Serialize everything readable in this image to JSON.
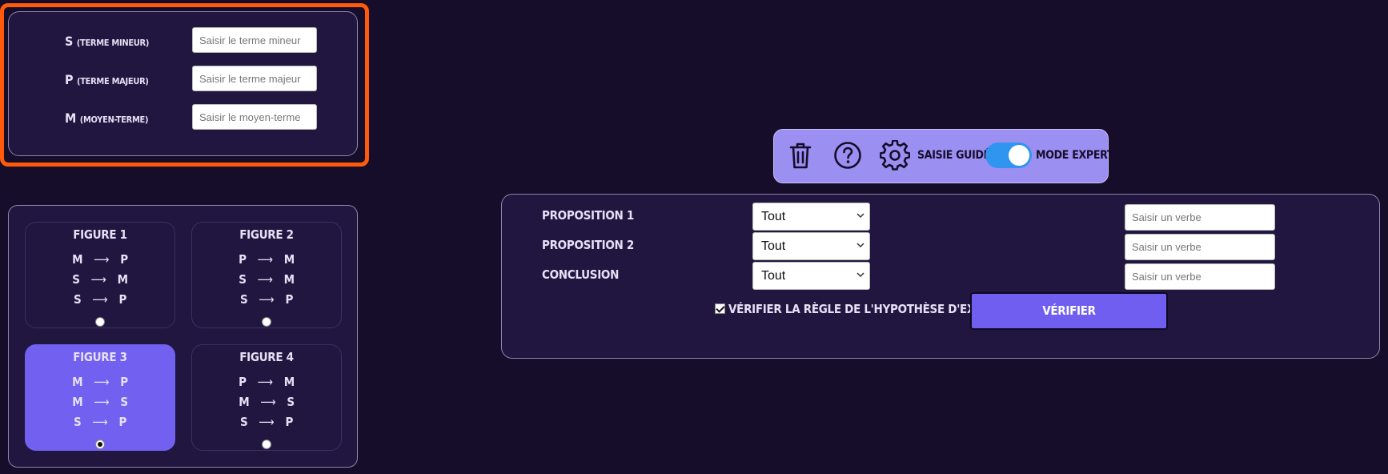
{
  "terms": {
    "s": {
      "letter": "S",
      "desc": "(TERME MINEUR)",
      "placeholder": "Saisir le terme mineur"
    },
    "p": {
      "letter": "P",
      "desc": "(TERME MAJEUR)",
      "placeholder": "Saisir le terme majeur"
    },
    "m": {
      "letter": "M",
      "desc": "(MOYEN-TERME)",
      "placeholder": "Saisir le moyen-terme"
    }
  },
  "figures": [
    {
      "title": "FIGURE 1",
      "lines": [
        [
          "M",
          "P"
        ],
        [
          "S",
          "M"
        ],
        [
          "S",
          "P"
        ]
      ],
      "selected": false
    },
    {
      "title": "FIGURE 2",
      "lines": [
        [
          "P",
          "M"
        ],
        [
          "S",
          "M"
        ],
        [
          "S",
          "P"
        ]
      ],
      "selected": false
    },
    {
      "title": "FIGURE 3",
      "lines": [
        [
          "M",
          "P"
        ],
        [
          "M",
          "S"
        ],
        [
          "S",
          "P"
        ]
      ],
      "selected": true
    },
    {
      "title": "FIGURE 4",
      "lines": [
        [
          "P",
          "M"
        ],
        [
          "M",
          "S"
        ],
        [
          "S",
          "P"
        ]
      ],
      "selected": false
    }
  ],
  "arrow": "⟶",
  "toolbar": {
    "delete_icon": "trash-icon",
    "help_icon": "help-icon",
    "settings_icon": "gear-icon",
    "guided_label": "SAISIE GUIDÉE",
    "expert_label": "MODE EXPERT",
    "expert_mode_on": true
  },
  "propositions": [
    {
      "label": "PROPOSITION 1",
      "quantifier": "Tout",
      "verb_placeholder": "Saisir un verbe"
    },
    {
      "label": "PROPOSITION 2",
      "quantifier": "Tout",
      "verb_placeholder": "Saisir un verbe"
    },
    {
      "label": "CONCLUSION",
      "quantifier": "Tout",
      "verb_placeholder": "Saisir un verbe"
    }
  ],
  "existence_check_label": "VÉRIFIER LA RÈGLE DE L'HYPOTHÈSE D'EXISTENCE",
  "existence_check_checked": true,
  "verify_label": "VÉRIFIER",
  "colors": {
    "background": "#160d2a",
    "panel": "#21163f",
    "accent": "#7261f0",
    "toolbar": "#9b8ff2",
    "toggle": "#2f95ee",
    "highlight": "#ff5a0a"
  }
}
